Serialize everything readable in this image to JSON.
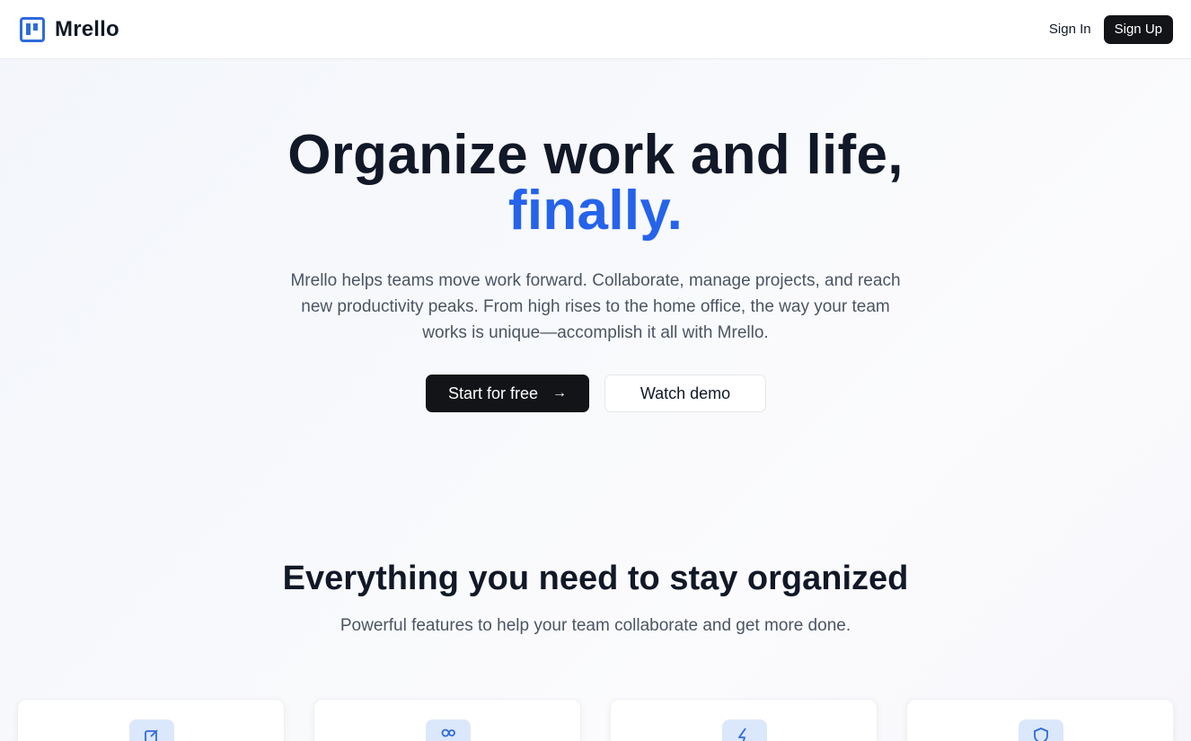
{
  "header": {
    "brand": "Mrello",
    "sign_in": "Sign In",
    "sign_up": "Sign Up"
  },
  "hero": {
    "title_line1": "Organize work and life,",
    "title_accent": "finally.",
    "description": "Mrello helps teams move work forward. Collaborate, manage projects, and reach new productivity peaks. From high rises to the home office, the way your team works is unique—accomplish it all with Mrello.",
    "primary_cta": "Start for free",
    "secondary_cta": "Watch demo"
  },
  "features": {
    "title": "Everything you need to stay organized",
    "subtitle": "Powerful features to help your team collaborate and get more done.",
    "cards": [
      {
        "icon": "edit-icon"
      },
      {
        "icon": "users-icon"
      },
      {
        "icon": "bolt-icon"
      },
      {
        "icon": "shield-icon"
      }
    ]
  },
  "colors": {
    "accent": "#2563eb",
    "logo": "#2f6bdc",
    "dark_button": "#131417",
    "icon_bg": "#dbe7fb"
  }
}
